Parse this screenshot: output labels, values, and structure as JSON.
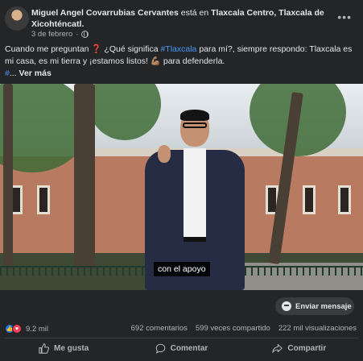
{
  "post": {
    "author": "Miguel Angel Covarrubias Cervantes",
    "is_at": "está en",
    "location": "Tlaxcala Centro, Tlaxcala de Xicohténcatl",
    "period": ".",
    "date": "3 de febrero",
    "separator": "·",
    "more_icon": "more-dots-icon",
    "privacy_icon": "globe-icon"
  },
  "caption": {
    "part1": "Cuando me preguntan ",
    "emoji_question": "❓",
    "part2": " ¿Qué significa ",
    "hashtag": "#Tlaxcala",
    "part3": " para mí?, siempre respondo: Tlaxcala es mi casa, es mi tierra y ¡estamos listos! ",
    "emoji_muscle": "💪🏽",
    "part4": " para defenderla.",
    "hash_fragment": "#",
    "ellipsis": "... ",
    "see_more": "Ver más"
  },
  "video": {
    "subtitle": "con el apoyo"
  },
  "message_button": {
    "label": "Enviar mensaje",
    "icon": "messenger-icon"
  },
  "stats": {
    "reactions_count": "9.2 mil",
    "comments": "692 comentarios",
    "shares": "599 veces compartido",
    "views": "222 mil visualizaciones"
  },
  "actions": {
    "like": "Me gusta",
    "comment": "Comentar",
    "share": "Compartir"
  },
  "colors": {
    "background": "#242526",
    "text": "#e4e6eb",
    "muted": "#b0b3b8",
    "link": "#4599ff",
    "like_blue": "#1877f2",
    "love_red": "#f33e58"
  }
}
